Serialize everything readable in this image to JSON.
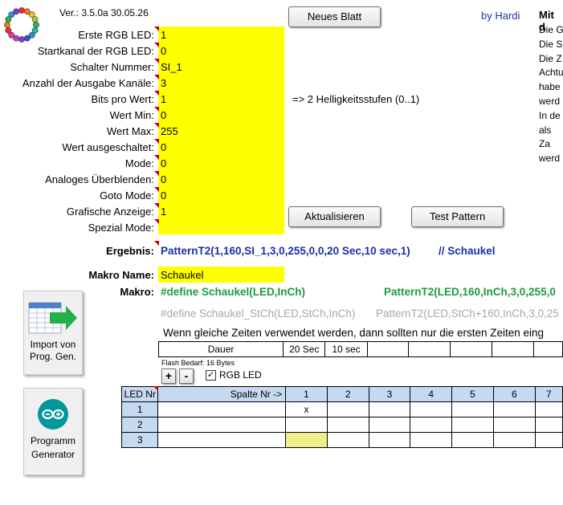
{
  "header": {
    "version": "Ver.: 3.5.0a 30.05.26",
    "author": "by Hardi",
    "right_title": "Mit d",
    "right_lines": [
      "Die G",
      "Die S",
      "Die Z",
      "Achtu",
      "habe",
      "werd",
      "In de",
      "als Za",
      "werd"
    ]
  },
  "buttons": {
    "new_sheet": "Neues Blatt",
    "refresh": "Aktualisieren",
    "test_pattern": "Test Pattern",
    "plus": "+",
    "minus": "-"
  },
  "fields": [
    {
      "label": "Erste RGB LED:",
      "value": "1"
    },
    {
      "label": "Startkanal der RGB LED:",
      "value": "0"
    },
    {
      "label": "Schalter Nummer:",
      "value": "SI_1"
    },
    {
      "label": "Anzahl der Ausgabe Kanäle:",
      "value": "3"
    },
    {
      "label": "Bits pro Wert:",
      "value": "1"
    },
    {
      "label": "Wert Min:",
      "value": "0"
    },
    {
      "label": "Wert Max:",
      "value": "255"
    },
    {
      "label": "Wert ausgeschaltet:",
      "value": "0"
    },
    {
      "label": "Mode:",
      "value": "0"
    },
    {
      "label": "Analoges Überblenden:",
      "value": "0"
    },
    {
      "label": "Goto Mode:",
      "value": "0"
    },
    {
      "label": "Grafische Anzeige:",
      "value": "1"
    },
    {
      "label": "Spezial Mode:",
      "value": ""
    }
  ],
  "brightness_note": "=> 2 Helligkeitsstufen (0..1)",
  "result": {
    "label": "Ergebnis:",
    "value": "PatternT2(1,160,SI_1,3,0,255,0,0,20 Sec,10 sec,1)",
    "comment": "// Schaukel"
  },
  "macro_name": {
    "label": "Makro Name:",
    "value": "Schaukel"
  },
  "macro": {
    "label": "Makro:",
    "define": "#define Schaukel(LED,InCh)",
    "pattern": "PatternT2(LED,160,InCh,3,0,255,0",
    "define_grey": "#define Schaukel_StCh(LED,StCh,InCh)",
    "pattern_grey": "PatternT2(LED,StCh+160,InCh,3,0,25"
  },
  "hint": "Wenn gleiche Zeiten verwendet werden, dann sollten nur die ersten Zeiten eing",
  "duration_row": {
    "label": "Dauer",
    "times": [
      "20 Sec",
      "10 sec",
      "",
      "",
      "",
      "",
      ""
    ]
  },
  "flash": "Flash Bedarf: 16 Bytes",
  "rgb_checkbox": {
    "label": "RGB LED",
    "checked": true,
    "mark": "✓"
  },
  "led_table": {
    "led_header": "LED Nr",
    "col_header": "Spalte Nr  ->",
    "columns": [
      "1",
      "2",
      "3",
      "4",
      "5",
      "6",
      "7"
    ],
    "rows": [
      {
        "nr": "1",
        "cells": [
          "x",
          "",
          "",
          "",
          "",
          "",
          ""
        ]
      },
      {
        "nr": "2",
        "cells": [
          "",
          "",
          "",
          "",
          "",
          "",
          ""
        ]
      },
      {
        "nr": "3",
        "cells": [
          "",
          "",
          "",
          "",
          "",
          "",
          ""
        ]
      }
    ]
  },
  "side_buttons": {
    "import": [
      "Import von",
      "Prog. Gen."
    ],
    "generator": [
      "Programm",
      "Generator"
    ]
  },
  "colors": {
    "input_yellow": "#ffff00",
    "header_blue": "#c5d9f1",
    "result_blue": "#1b2fa6",
    "macro_green": "#1e9b3c",
    "arduino_teal": "#00979d",
    "import_arrow_green": "#22b04b"
  }
}
